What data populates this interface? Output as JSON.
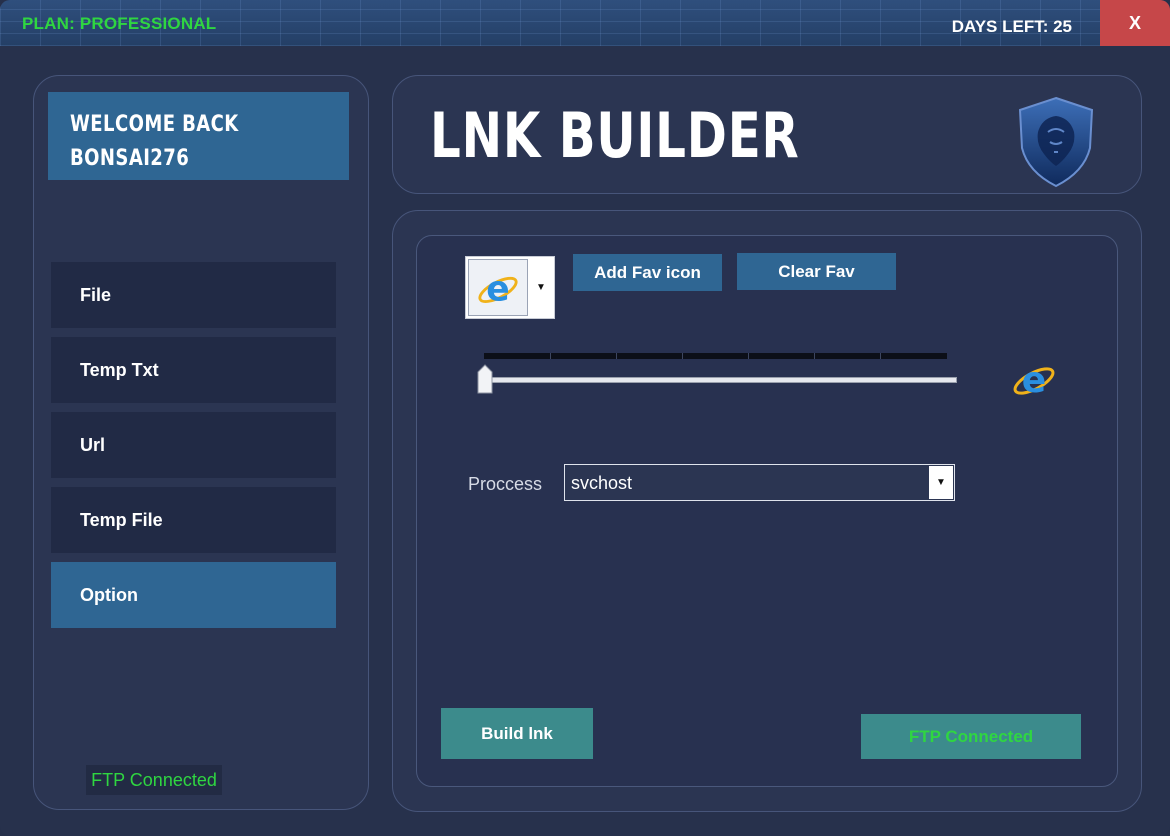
{
  "titlebar": {
    "plan": "PLAN: PROFESSIONAL",
    "days_left": "DAYS LEFT: 25",
    "close_label": "X"
  },
  "welcome": {
    "line1": "WELCOME BACK",
    "line2": "BONSAI276"
  },
  "sidebar": {
    "items": [
      {
        "label": "File"
      },
      {
        "label": "Temp Txt"
      },
      {
        "label": "Url"
      },
      {
        "label": "Temp File"
      },
      {
        "label": "Option"
      }
    ],
    "active": "Option",
    "ftp_status": "FTP Connected"
  },
  "header": {
    "title": "LNK BUILDER",
    "logo_icon": "lion-shield-icon"
  },
  "options": {
    "icon_picker_icon": "internet-explorer-icon",
    "add_fav_label": "Add Fav icon",
    "clear_fav_label": "Clear Fav",
    "slider_value": 0,
    "preview_icon": "internet-explorer-icon",
    "process_label": "Proccess",
    "process_value": "svchost",
    "build_label": "Build lnk",
    "ftp_status": "FTP Connected"
  },
  "colors": {
    "status_green": "#2fd641",
    "accent_blue": "#2f6693",
    "teal": "#3c8b8c",
    "close_red": "#c64749"
  }
}
